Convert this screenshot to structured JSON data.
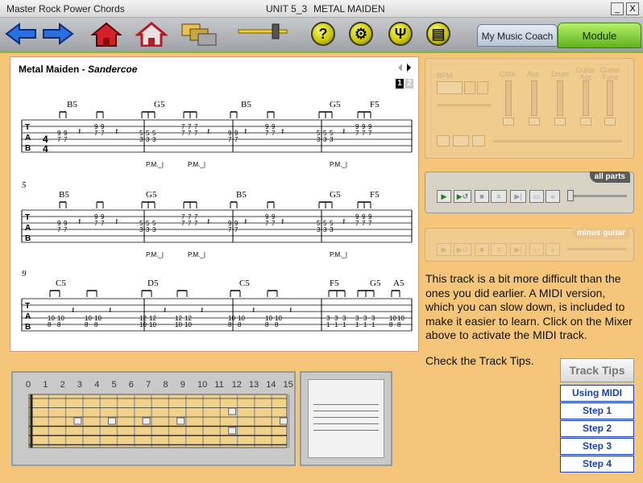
{
  "window": {
    "title_left": "Master Rock Power Chords",
    "unit": "UNIT 5_3",
    "song": "METAL MAIDEN",
    "min_btn": "_",
    "close_btn": "X"
  },
  "tabs": {
    "coach": "My Music Coach",
    "module": "Module"
  },
  "toolbar": {
    "help": "?"
  },
  "score": {
    "title": "Metal Maiden - ",
    "composer": "Sandercoe",
    "page_active": "1",
    "page_other": "2",
    "pm": "P.M._|",
    "systems": [
      {
        "num": "",
        "chords": [
          "B5",
          "G5",
          "B5",
          "G5",
          "F5"
        ]
      },
      {
        "num": "5",
        "chords": [
          "B5",
          "G5",
          "B5",
          "G5",
          "F5"
        ]
      },
      {
        "num": "9",
        "chords": [
          "C5",
          "D5",
          "C5",
          "F5",
          "G5",
          "A5"
        ]
      }
    ],
    "fret_nums": [
      "9",
      "7",
      "5",
      "3",
      "10",
      "8",
      "12"
    ]
  },
  "mixer": {
    "bpm": "BPM",
    "labels": [
      "Click",
      "Acc",
      "Drum",
      "Guitar Acc",
      "Guitar Tune"
    ]
  },
  "players": {
    "all_parts": "all parts",
    "minus_guitar": "minus guitar"
  },
  "desc": "This track is a bit more difficult than the ones you did earlier. A MIDI version, which you can slow down, is included to make it easier to learn. Click on the Mixer above to activate the MIDI track.",
  "tip": "Check the Track Tips.",
  "track_tips": {
    "header": "Track Tips",
    "items": [
      "Using MIDI",
      "Step 1",
      "Step 2",
      "Step 3",
      "Step 4"
    ]
  },
  "fretboard": {
    "numbers": [
      "0",
      "1",
      "2",
      "3",
      "4",
      "5",
      "6",
      "7",
      "8",
      "9",
      "10",
      "11",
      "12",
      "13",
      "14",
      "15"
    ]
  },
  "colors": {
    "bg": "#f5c67a",
    "tab_green": "#7fb94a",
    "link_blue": "#1a3fae"
  }
}
